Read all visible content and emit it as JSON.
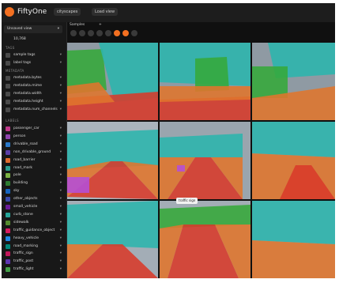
{
  "app": {
    "brand": "FiftyOne",
    "dataset": "cityscapes",
    "dataset_button": "Load view"
  },
  "sidebar": {
    "view_label": "Unsaved view",
    "count": "10,768",
    "sections": {
      "tags": "TAGS",
      "metadata": "METADATA",
      "labels": "LABELS"
    },
    "tags": [
      {
        "label": "sample tags"
      },
      {
        "label": "label tags"
      }
    ],
    "metadata": [
      {
        "label": "metadata.bytes"
      },
      {
        "label": "metadata.mime"
      },
      {
        "label": "metadata.width"
      },
      {
        "label": "metadata.height"
      },
      {
        "label": "metadata.num_channels"
      }
    ],
    "labels": [
      {
        "label": "passenger_car",
        "color": "#c0398b"
      },
      {
        "label": "person",
        "color": "#8e44ad"
      },
      {
        "label": "drivable_road",
        "color": "#2b79c9"
      },
      {
        "label": "non_drivable_ground",
        "color": "#5a3ea8"
      },
      {
        "label": "road_barrier",
        "color": "#e06b2e"
      },
      {
        "label": "road_mark",
        "color": "#2a9d8f"
      },
      {
        "label": "pole",
        "color": "#7cb342"
      },
      {
        "label": "building",
        "color": "#2e7d32"
      },
      {
        "label": "sky",
        "color": "#1565c0"
      },
      {
        "label": "other_objects",
        "color": "#3949ab"
      },
      {
        "label": "small_vehicle",
        "color": "#6a1b9a"
      },
      {
        "label": "curb_stone",
        "color": "#26a69a"
      },
      {
        "label": "sidewalk",
        "color": "#558b2f"
      },
      {
        "label": "traffic_guidance_object",
        "color": "#d81b60"
      },
      {
        "label": "heavy_vehicle",
        "color": "#1e88e5"
      },
      {
        "label": "road_marking",
        "color": "#00897b"
      },
      {
        "label": "traffic_sign",
        "color": "#c2185b"
      },
      {
        "label": "traffic_post",
        "color": "#5e35b1"
      },
      {
        "label": "traffic_light",
        "color": "#43a047"
      }
    ]
  },
  "main": {
    "tabs": [
      "Samples",
      "+"
    ],
    "tooltip": "traffic sign"
  },
  "colors": {
    "road": "#d83a2a",
    "vegetation": "#2bb5ad",
    "ground": "#e0752c",
    "building": "#36a83a",
    "sky": "#8f9aa3",
    "vehicle": "#b44fd8",
    "accent": "#f37021"
  }
}
